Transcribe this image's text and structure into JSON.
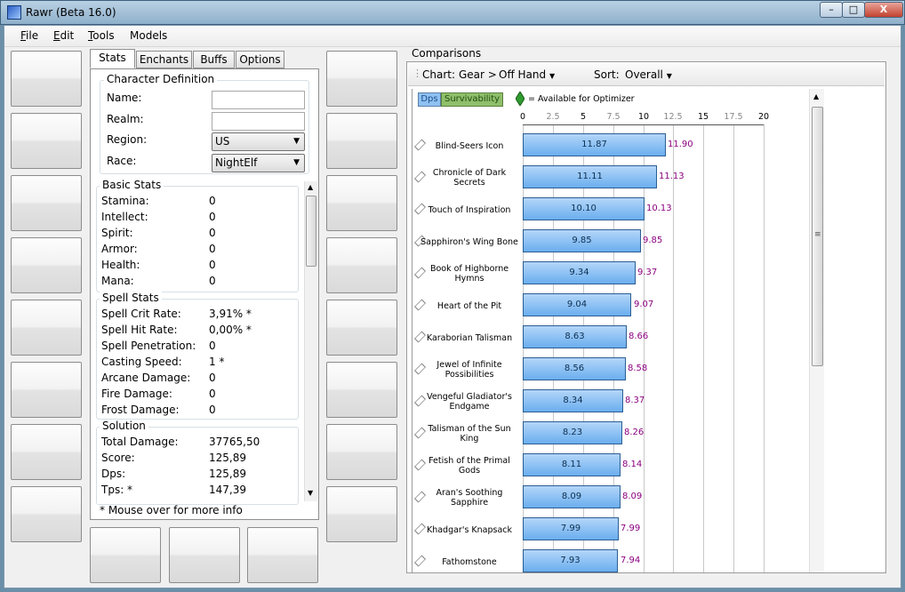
{
  "window": {
    "title": "Rawr (Beta 16.0)",
    "min": "–",
    "max": "□",
    "close": "X"
  },
  "menu": {
    "file_u": "F",
    "file_r": "ile",
    "edit_u": "E",
    "edit_r": "dit",
    "tools_u": "T",
    "tools_r": "ools",
    "models": "Models"
  },
  "tabs": [
    "Stats",
    "Enchants",
    "Buffs",
    "Options"
  ],
  "character": {
    "title": "Character Definition",
    "name_label": "Name:",
    "realm_label": "Realm:",
    "region_label": "Region:",
    "region_value": "US",
    "race_label": "Race:",
    "race_value": "NightElf"
  },
  "basic": {
    "title": "Basic Stats",
    "rows": [
      [
        "Stamina:",
        "0"
      ],
      [
        "Intellect:",
        "0"
      ],
      [
        "Spirit:",
        "0"
      ],
      [
        "Armor:",
        "0"
      ],
      [
        "Health:",
        "0"
      ],
      [
        "Mana:",
        "0"
      ]
    ]
  },
  "spell": {
    "title": "Spell Stats",
    "rows": [
      [
        "Spell Crit Rate:",
        "3,91% *"
      ],
      [
        "Spell Hit Rate:",
        "0,00% *"
      ],
      [
        "Spell Penetration:",
        "0"
      ],
      [
        "Casting Speed:",
        "1 *"
      ],
      [
        "Arcane Damage:",
        "0"
      ],
      [
        "Fire Damage:",
        "0"
      ],
      [
        "Frost Damage:",
        "0"
      ]
    ]
  },
  "solution": {
    "title": "Solution",
    "rows": [
      [
        "Total Damage:",
        "37765,50"
      ],
      [
        "Score:",
        "125,89"
      ],
      [
        "Dps:",
        "125,89"
      ],
      [
        "Tps: *",
        "147,39"
      ]
    ]
  },
  "footnote": "* Mouse over for more info",
  "comparisons": {
    "title": "Comparisons",
    "chart_label": "Chart:",
    "chart_gear": "Gear >",
    "chart_offhand": "Off Hand",
    "sort_label": "Sort:",
    "sort_value": "Overall",
    "legend_dps": "Dps",
    "legend_surv": "Survivability",
    "optimizer_note": "= Available for Optimizer",
    "accent_dps": "#8fc1f2",
    "accent_surv": "#8fbf6a",
    "gem_color": "#2e9b2e"
  },
  "chart_data": {
    "type": "bar",
    "orientation": "horizontal",
    "xlim": [
      0,
      20
    ],
    "ticks": [
      "0",
      "2.5",
      "5",
      "7.5",
      "10",
      "12.5",
      "15",
      "17.5",
      "20"
    ],
    "categories": [
      "Blind-Seers Icon",
      "Chronicle of Dark Secrets",
      "Touch of Inspiration",
      "Sapphiron's Wing Bone",
      "Book of Highborne Hymns",
      "Heart of the Pit",
      "Karaborian Talisman",
      "Jewel of Infinite Possibilities",
      "Vengeful Gladiator's Endgame",
      "Talisman of the Sun King",
      "Fetish of the Primal Gods",
      "Aran's Soothing Sapphire",
      "Khadgar's Knapsack",
      "Fathomstone"
    ],
    "series": [
      {
        "name": "Dps",
        "values": [
          11.87,
          11.11,
          10.1,
          9.85,
          9.34,
          9.04,
          8.63,
          8.56,
          8.34,
          8.23,
          8.11,
          8.09,
          7.99,
          7.93
        ]
      }
    ],
    "overall": [
      11.9,
      11.13,
      10.13,
      9.85,
      9.37,
      9.07,
      8.66,
      8.58,
      8.37,
      8.26,
      8.14,
      8.09,
      7.99,
      7.94
    ]
  }
}
